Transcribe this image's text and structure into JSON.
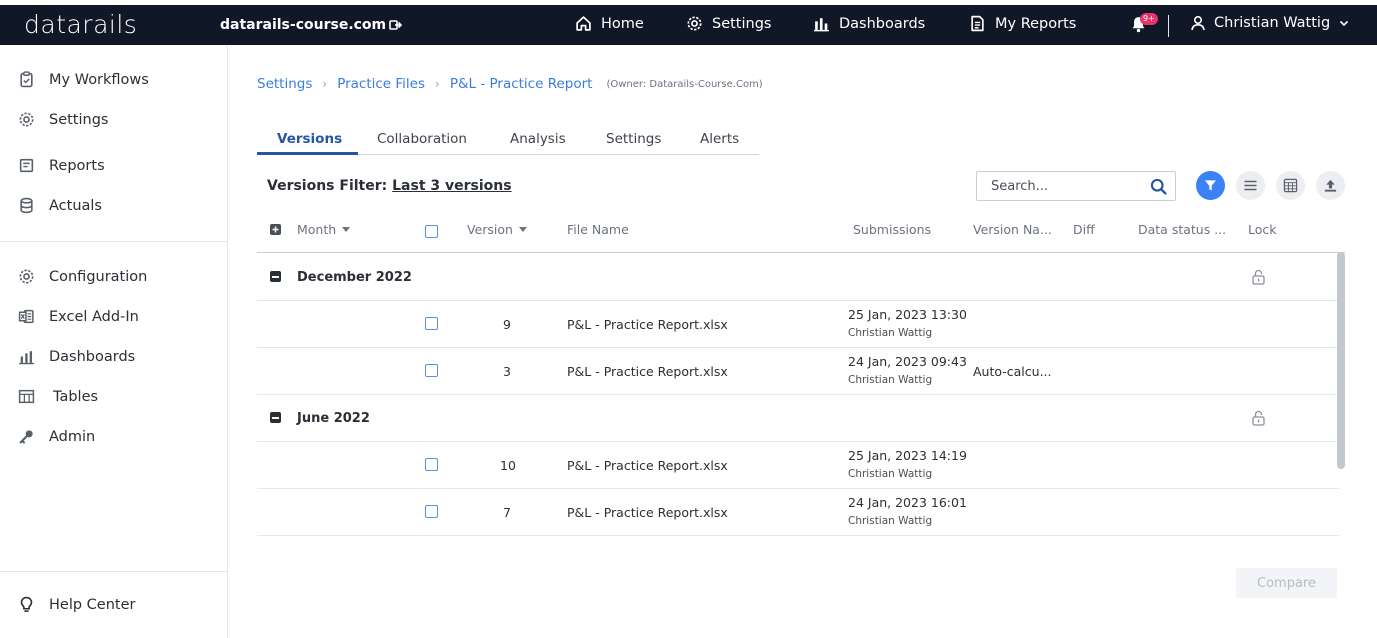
{
  "topbar": {
    "logo": "datarails",
    "domain": "datarails-course.com",
    "nav": [
      {
        "label": "Home",
        "icon": "home-icon"
      },
      {
        "label": "Settings",
        "icon": "gear-icon"
      },
      {
        "label": "Dashboards",
        "icon": "bar-chart-icon"
      },
      {
        "label": "My Reports",
        "icon": "document-icon"
      }
    ],
    "notifications_badge": "9+",
    "user_name": "Christian Wattig"
  },
  "sidebar": {
    "group1": [
      {
        "label": "My Workflows",
        "icon": "clipboard-icon"
      },
      {
        "label": "Settings",
        "icon": "gear-icon"
      },
      {
        "label": "Reports",
        "icon": "report-icon"
      },
      {
        "label": "Actuals",
        "icon": "database-icon"
      }
    ],
    "group2": [
      {
        "label": "Configuration",
        "icon": "gear-icon"
      },
      {
        "label": "Excel Add-In",
        "icon": "excel-icon"
      },
      {
        "label": "Dashboards",
        "icon": "bar-chart-icon"
      },
      {
        "label": "Tables",
        "icon": "table-icon"
      },
      {
        "label": "Admin",
        "icon": "key-icon"
      }
    ],
    "help": {
      "label": "Help Center",
      "icon": "lightbulb-icon"
    }
  },
  "breadcrumb": {
    "items": [
      "Settings",
      "Practice Files",
      "P&L - Practice Report"
    ],
    "owner": "(Owner: Datarails-Course.Com)"
  },
  "tabs": [
    "Versions",
    "Collaboration",
    "Analysis",
    "Settings",
    "Alerts"
  ],
  "filter": {
    "label": "Versions Filter:",
    "value": "Last 3 versions"
  },
  "search": {
    "placeholder": "Search..."
  },
  "columns": {
    "month": "Month",
    "version": "Version",
    "file_name": "File Name",
    "submissions": "Submissions",
    "version_name": "Version Na...",
    "diff": "Diff",
    "data_status": "Data status ...",
    "lock": "Lock"
  },
  "groups": [
    {
      "month": "December 2022",
      "rows": [
        {
          "version": "9",
          "file": "P&L - Practice Report.xlsx",
          "date": "25 Jan, 2023 13:30",
          "user": "Christian Wattig",
          "version_name": ""
        },
        {
          "version": "3",
          "file": "P&L - Practice Report.xlsx",
          "date": "24 Jan, 2023 09:43",
          "user": "Christian Wattig",
          "version_name": "Auto-calcu..."
        }
      ]
    },
    {
      "month": "June 2022",
      "rows": [
        {
          "version": "10",
          "file": "P&L - Practice Report.xlsx",
          "date": "25 Jan, 2023 14:19",
          "user": "Christian Wattig",
          "version_name": ""
        },
        {
          "version": "7",
          "file": "P&L - Practice Report.xlsx",
          "date": "24 Jan, 2023 16:01",
          "user": "Christian Wattig",
          "version_name": ""
        }
      ]
    }
  ],
  "compare_label": "Compare",
  "colors": {
    "topbar": "#101828",
    "accent": "#3b7ddd",
    "tab_active": "#2456a6",
    "filter_button": "#3b82f6",
    "badge": "#e8336b"
  }
}
